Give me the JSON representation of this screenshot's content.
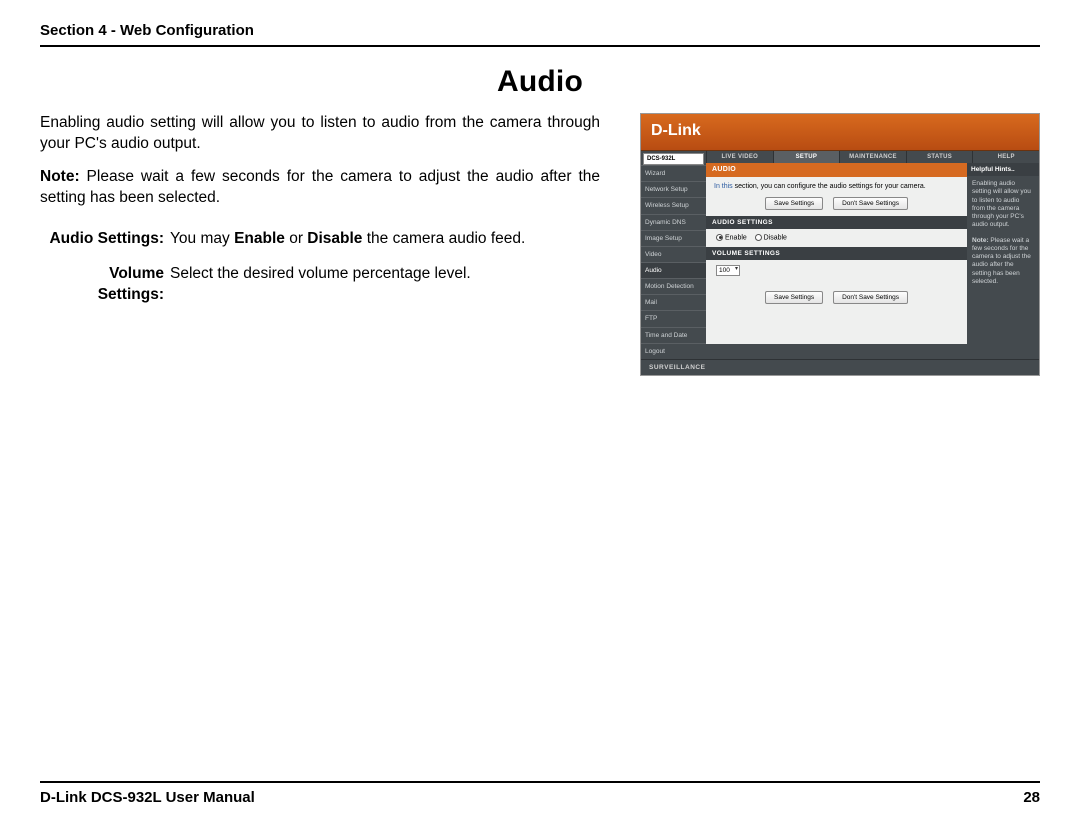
{
  "header": {
    "section": "Section 4 - Web Configuration"
  },
  "title": "Audio",
  "body": {
    "p1": "Enabling audio setting will allow you to listen to audio from the camera through your PC's audio output.",
    "note_label": "Note:",
    "p2": " Please wait a few seconds for the camera to adjust the audio after the setting has been selected.",
    "defs": [
      {
        "label": "Audio Settings:",
        "pre": "You may ",
        "b1": "Enable",
        "mid": " or ",
        "b2": "Disable",
        "post": " the camera audio feed."
      },
      {
        "label": "Volume Settings:",
        "text": "Select the desired volume percentage level."
      }
    ]
  },
  "shot": {
    "brand": "D-Link",
    "model": "DCS-932L",
    "tabs": [
      "LIVE VIDEO",
      "SETUP",
      "MAINTENANCE",
      "STATUS",
      "HELP"
    ],
    "active_tab": 1,
    "side_items": [
      "Wizard",
      "Network Setup",
      "Wireless Setup",
      "Dynamic DNS",
      "Image Setup",
      "Video",
      "Audio",
      "Motion Detection",
      "Mail",
      "FTP",
      "Time and Date",
      "Logout"
    ],
    "side_active": 6,
    "panel_title": "AUDIO",
    "panel_sub_pre": "In this ",
    "panel_sub_mid": "section, you can configure the audio settings for your camera.",
    "save": "Save Settings",
    "dont_save": "Don't Save Settings",
    "audio_sect": "AUDIO SETTINGS",
    "enable": "Enable",
    "disable": "Disable",
    "vol_sect": "VOLUME SETTINGS",
    "vol_value": "100",
    "hints_title": "Helpful Hints..",
    "hints_p1": "Enabling audio setting will allow you to listen to audio from the camera through your PC's audio output.",
    "hints_note": "Note:",
    "hints_p2": " Please wait a few seconds for the camera to adjust the audio after the setting has been selected.",
    "footer": "SURVEILLANCE"
  },
  "footer": {
    "left": "D-Link DCS-932L User Manual",
    "right": "28"
  }
}
